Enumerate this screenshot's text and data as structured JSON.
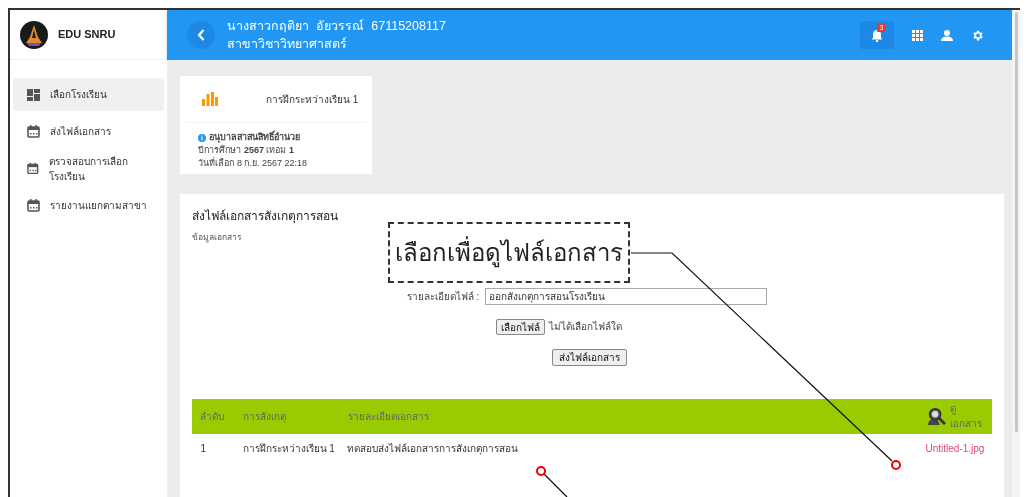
{
  "app": {
    "name": "EDU SNRU"
  },
  "header": {
    "student": "นางสาวกฤติยา  อัยวรรณ์  67115208117",
    "program": "สาขาวิชาวิทยาศาสตร์",
    "notification_count": "3"
  },
  "sidebar": {
    "items": [
      {
        "label": "เลือกโรงเรียน",
        "selected": true,
        "kind": "dashboard"
      },
      {
        "label": "ส่งไฟล์เอกสาร",
        "selected": false,
        "kind": "calendar"
      },
      {
        "label": "ตรวจสอบการเลือกโรงเรียน",
        "selected": false,
        "kind": "calendar"
      },
      {
        "label": "รายงานแยกตามสาขา",
        "selected": false,
        "kind": "calendar"
      }
    ]
  },
  "summary_card": {
    "title": "การฝึกระหว่างเรียน 1",
    "school": "อนุบาลสาสนสิทธิ์อำนวย",
    "year_line": "ปีการศึกษา **2567** เทอม **1**",
    "date": "วันที่เลือก 8 ก.ย. 2567 22:18"
  },
  "upload": {
    "title": "ส่งไฟล์เอกสารสังเกตุการสอน",
    "subtitle": "ข้อมูลเอกสาร",
    "detail_label": "รายละเอียดไฟล์ :",
    "detail_value": "ออกสังเกตุการสอนโรงเรียน",
    "choose_button": "เลือกไฟล์",
    "no_file": "ไม่ได้เลือกไฟล์ใด",
    "submit": "ส่งไฟล์เอกสาร"
  },
  "table": {
    "columns": [
      "ลำดับ",
      "การสังเกตุ",
      "รายละเอียดเอกสาร",
      "ดูเอกสาร"
    ],
    "rows": [
      {
        "cells": [
          "1",
          "การฝึกระหว่างเรียน 1",
          "ทดสอบส่งไฟล์เอกสารการสังเกตุการสอน"
        ],
        "file": "Untitled-1.jpg"
      }
    ]
  },
  "callout": {
    "text": "เลือกเพื่อดูไฟล์เอกสาร"
  }
}
